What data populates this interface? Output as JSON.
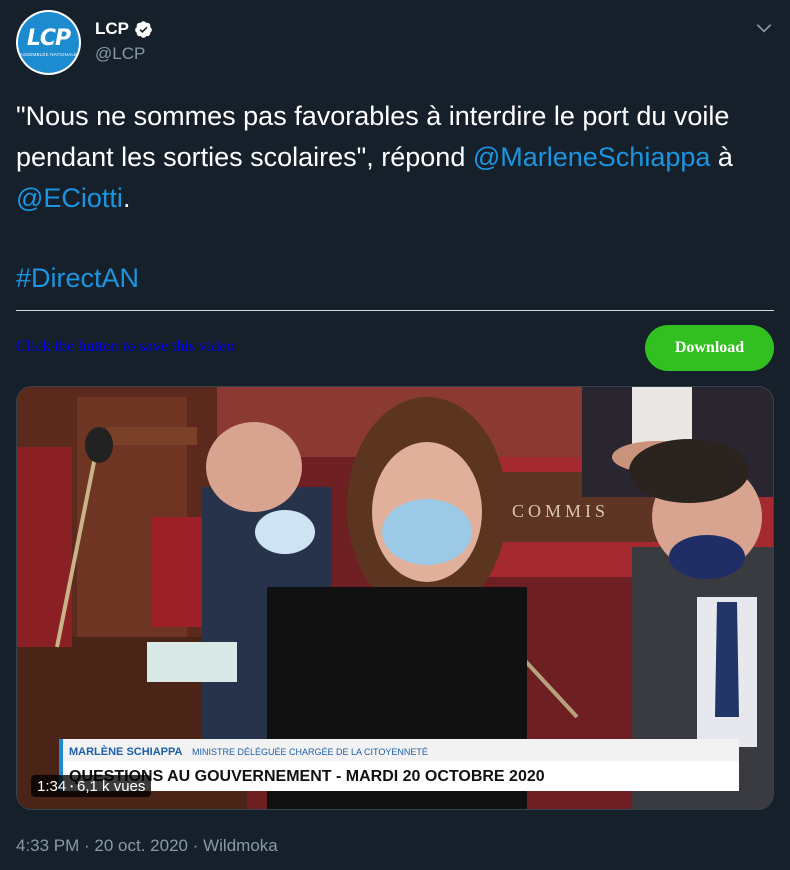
{
  "header": {
    "avatar_logo": "LCP",
    "avatar_subtitle": "Assemblée nationale",
    "display_name": "LCP",
    "handle": "@LCP",
    "verified_icon": "verified-badge-icon",
    "menu_icon": "chevron-down-icon"
  },
  "tweet": {
    "text_part1": "\"Nous ne sommes pas favorables à interdire le port du voile pendant les sorties scolaires\", répond ",
    "mention1": "@MarleneSchiappa",
    "text_part2": " à ",
    "mention2": "@ECiotti",
    "text_part3": ".",
    "hashtag": "#DirectAN"
  },
  "download_bar": {
    "prompt": "Click the button to save this video",
    "button_label": "Download"
  },
  "video": {
    "sign_text": "COMMIS",
    "banner_name": "MARLÈNE SCHIAPPA",
    "banner_role": "MINISTRE DÉLÉGUÉE CHARGÉE DE LA CITOYENNETÉ",
    "banner_title": "QUESTIONS AU GOUVERNEMENT - MARDI 20 OCTOBRE 2020",
    "duration": "1:34",
    "separator": "•",
    "views": "6,1 k vues"
  },
  "footer": {
    "time": "4:33 PM",
    "sep1": " · ",
    "date": "20 oct. 2020",
    "sep2": " · ",
    "source": "Wildmoka"
  },
  "colors": {
    "background": "#15202b",
    "link": "#1b95e0",
    "secondary_text": "#8899a6",
    "download_button": "#32c021",
    "avatar_blue": "#1d8bd0"
  }
}
